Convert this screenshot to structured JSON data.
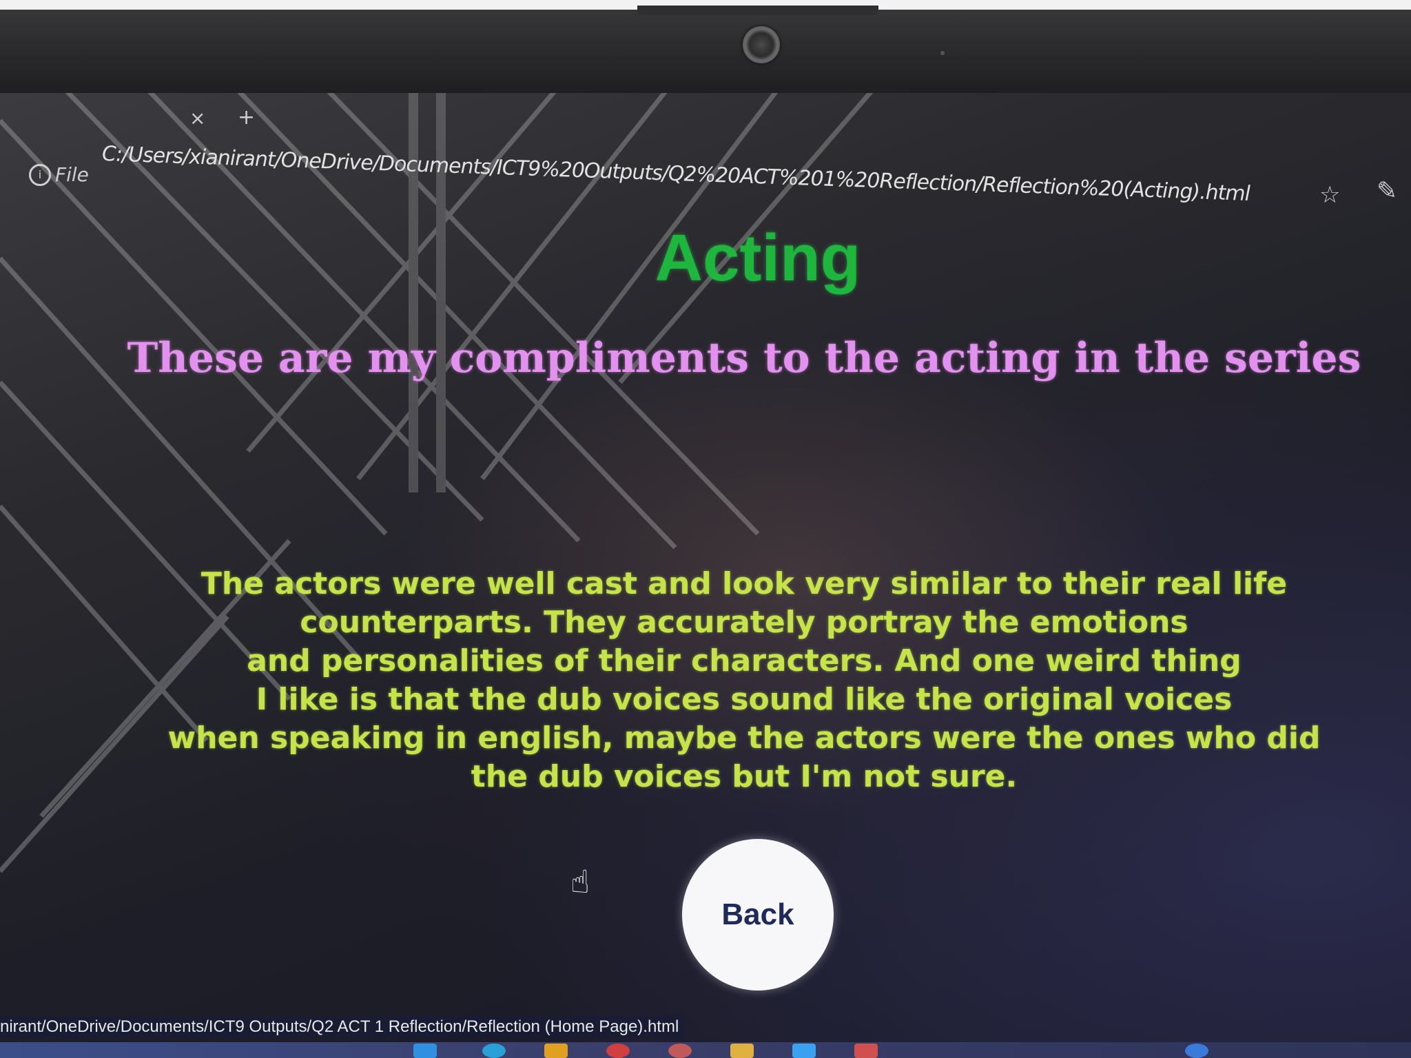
{
  "browser": {
    "file_label": "File",
    "address": "C:/Users/xianirant/OneDrive/Documents/ICT9%20Outputs/Q2%20ACT%201%20Reflection/Reflection%20(Acting).html",
    "status_url": "nirant/OneDrive/Documents/ICT9 Outputs/Q2 ACT 1 Reflection/Reflection (Home Page).html"
  },
  "page": {
    "heading": "Acting",
    "subheading": "These are my compliments to the acting in the series",
    "paragraph_lines": [
      "The actors were well cast and look very similar to their real life",
      "counterparts. They accurately portray the emotions",
      "and personalities of their characters. And one weird thing",
      "I like is that the dub voices sound like the original voices",
      "when speaking in english, maybe the actors were the ones who did",
      "the dub voices but I'm not sure."
    ],
    "back_label": "Back"
  },
  "icons": {
    "tab_close": "close-icon",
    "tab_new": "plus-icon",
    "info": "info-icon",
    "favorite": "star-icon",
    "edit": "edit-icon",
    "cursor": "hand-cursor-icon"
  },
  "colors": {
    "heading": "#1fb63e",
    "subheading": "#e391ef",
    "paragraph": "#c6e34a",
    "back_button_bg": "#f7f7f9",
    "back_button_text": "#1e2a5a"
  }
}
